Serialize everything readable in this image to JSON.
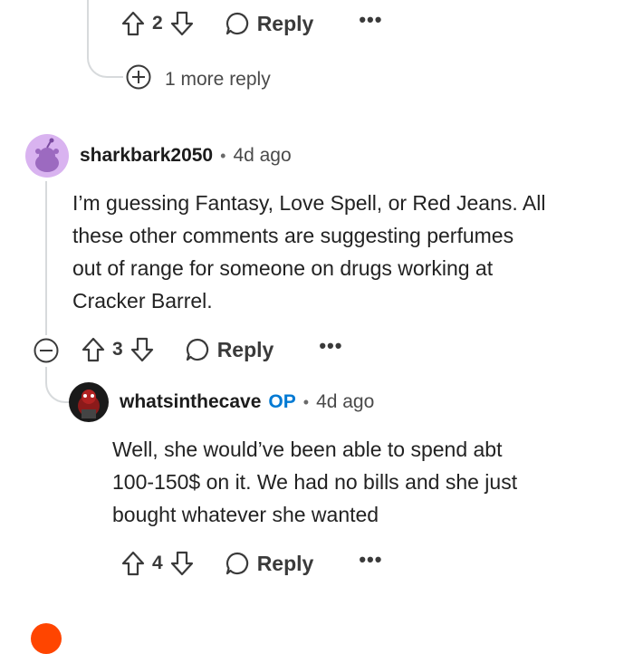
{
  "top_comment_actions": {
    "vote_count": "2",
    "reply_label": "Reply",
    "more_label": "•••"
  },
  "more_replies": {
    "label": "1 more reply"
  },
  "comment1": {
    "username": "sharkbark2050",
    "age": "4d ago",
    "body_lines": [
      "I’m guessing Fantasy, Love Spell, or Red Jeans. All",
      "these other comments are suggesting perfumes",
      "out of range for someone on drugs working at",
      "Cracker Barrel."
    ],
    "vote_count": "3",
    "reply_label": "Reply",
    "more_label": "•••"
  },
  "comment2": {
    "username": "whatsinthecave",
    "op_tag": "OP",
    "age": "4d ago",
    "body_lines": [
      "Well, she would’ve been able to spend abt",
      "100-150$ on it. We had no bills and she just",
      "bought whatever she wanted"
    ],
    "vote_count": "4",
    "reply_label": "Reply",
    "more_label": "•••"
  },
  "separator": "•",
  "colors": {
    "op_blue": "#0079d3",
    "avatar1_bg": "#d9b3f0",
    "thread_line": "#d7dadc"
  }
}
